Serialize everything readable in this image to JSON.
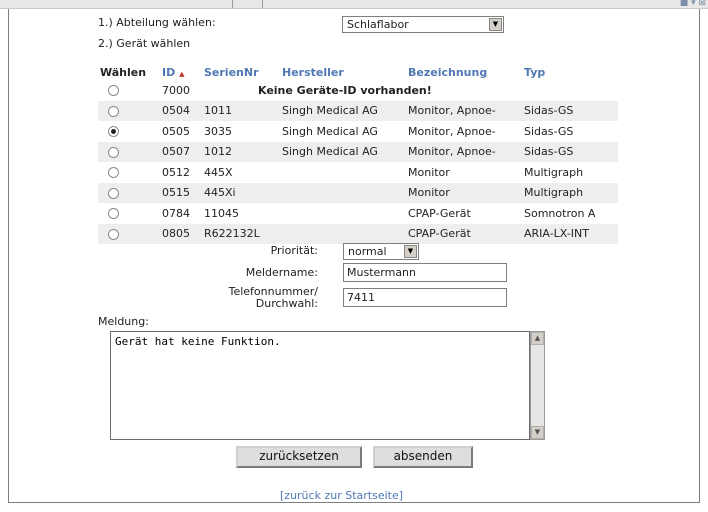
{
  "steps": {
    "step1_label": "1.) Abteilung wählen:",
    "step2_label": "2.) Gerät wählen"
  },
  "department_select": {
    "value": "Schlaflabor"
  },
  "table": {
    "headers": {
      "select": "Wählen",
      "id": "ID",
      "sort_indicator": "▲",
      "serial": "SerienNr",
      "manufacturer": "Hersteller",
      "designation": "Bezeichnung",
      "type": "Typ"
    },
    "no_id_message": "Keine Geräte-ID vorhanden!",
    "rows": [
      {
        "id": "7000",
        "serial": "",
        "manufacturer": "",
        "designation": "",
        "type": "",
        "checked": false
      },
      {
        "id": "0504",
        "serial": "1011",
        "manufacturer": "Singh Medical AG",
        "designation": "Monitor, Apnoe-",
        "type": "Sidas-GS",
        "checked": false
      },
      {
        "id": "0505",
        "serial": "3035",
        "manufacturer": "Singh Medical AG",
        "designation": "Monitor, Apnoe-",
        "type": "Sidas-GS",
        "checked": true
      },
      {
        "id": "0507",
        "serial": "1012",
        "manufacturer": "Singh Medical AG",
        "designation": "Monitor, Apnoe-",
        "type": "Sidas-GS",
        "checked": false
      },
      {
        "id": "0512",
        "serial": "445X",
        "manufacturer": "",
        "designation": "Monitor",
        "type": "Multigraph",
        "checked": false
      },
      {
        "id": "0515",
        "serial": "445Xi",
        "manufacturer": "",
        "designation": "Monitor",
        "type": "Multigraph",
        "checked": false
      },
      {
        "id": "0784",
        "serial": "11045",
        "manufacturer": "",
        "designation": "CPAP-Gerät",
        "type": "Somnotron A",
        "checked": false
      },
      {
        "id": "0805",
        "serial": "R622132L",
        "manufacturer": "",
        "designation": "CPAP-Gerät",
        "type": "ARIA-LX-INT",
        "checked": false
      }
    ]
  },
  "form": {
    "priority_label": "Priorität:",
    "priority_value": "normal",
    "reporter_label": "Meldername:",
    "reporter_value": "Mustermann",
    "phone_label_line1": "Telefonnummer/",
    "phone_label_line2": "Durchwahl:",
    "phone_value": "7411",
    "message_label": "Meldung:",
    "message_value": "Gerät hat keine Funktion."
  },
  "buttons": {
    "reset": "zurücksetzen",
    "submit": "absenden"
  },
  "footer": {
    "back_link": "[zurück zur Startseite]"
  },
  "colors": {
    "header_blue": "#4f78b4",
    "row_alt": "#eeeeee"
  }
}
